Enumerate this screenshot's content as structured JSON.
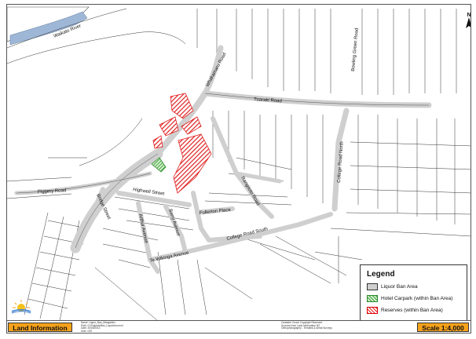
{
  "map": {
    "roads": {
      "waikato_river": "Waikato River",
      "whakamaru_road": "Whakamaru Road",
      "tuaraki_road": "Tuaraki Road",
      "bowling_green_road": "Bowling Green Road",
      "piggery_road": "Piggery Road",
      "college_road_north": "College Road North",
      "college_road_south": "College Road South",
      "bridge_street": "Bridge Street",
      "highwell_street": "Highwell Street",
      "arthur_avenue": "Arthur Avenue",
      "barry_avenue": "Barry Avenue",
      "fullerton_place": "Fullerton Place",
      "te_wikinga_avenue": "Te Wikinga Avenue",
      "rangitoto_road": "Rangitoto Road"
    },
    "colors": {
      "ban_area": "#cfcfcf",
      "hotel_carpark": "#3aa13a",
      "reserves": "#e02020",
      "river": "#9fb7d6"
    }
  },
  "legend": {
    "title": "Legend",
    "items": [
      {
        "label": "Liquor Ban Area",
        "icon": "grey-swatch"
      },
      {
        "label": "Hotel Carpark (within Ban Area)",
        "icon": "green-hatch-swatch"
      },
      {
        "label": "Reserves (within Ban Area)",
        "icon": "red-hatch-swatch"
      }
    ]
  },
  "titlebar": {
    "land_information": "Land Information",
    "scale": "Scale 1:4,000",
    "meta_lines": [
      "Name: Liquor_Ban_Mangakino",
      "Path: G:\\Projects\\Ban_Liquorban.mxd",
      "Date: 20/05/2013",
      "User: GIS"
    ],
    "copyright_lines": [
      "Cadastre Crown Copyright Reserved.",
      "Sourced from Land Information NZ.",
      "Orthophotography - Terralink & Aerial Surveys"
    ]
  },
  "north_arrow": {
    "label": "N"
  }
}
